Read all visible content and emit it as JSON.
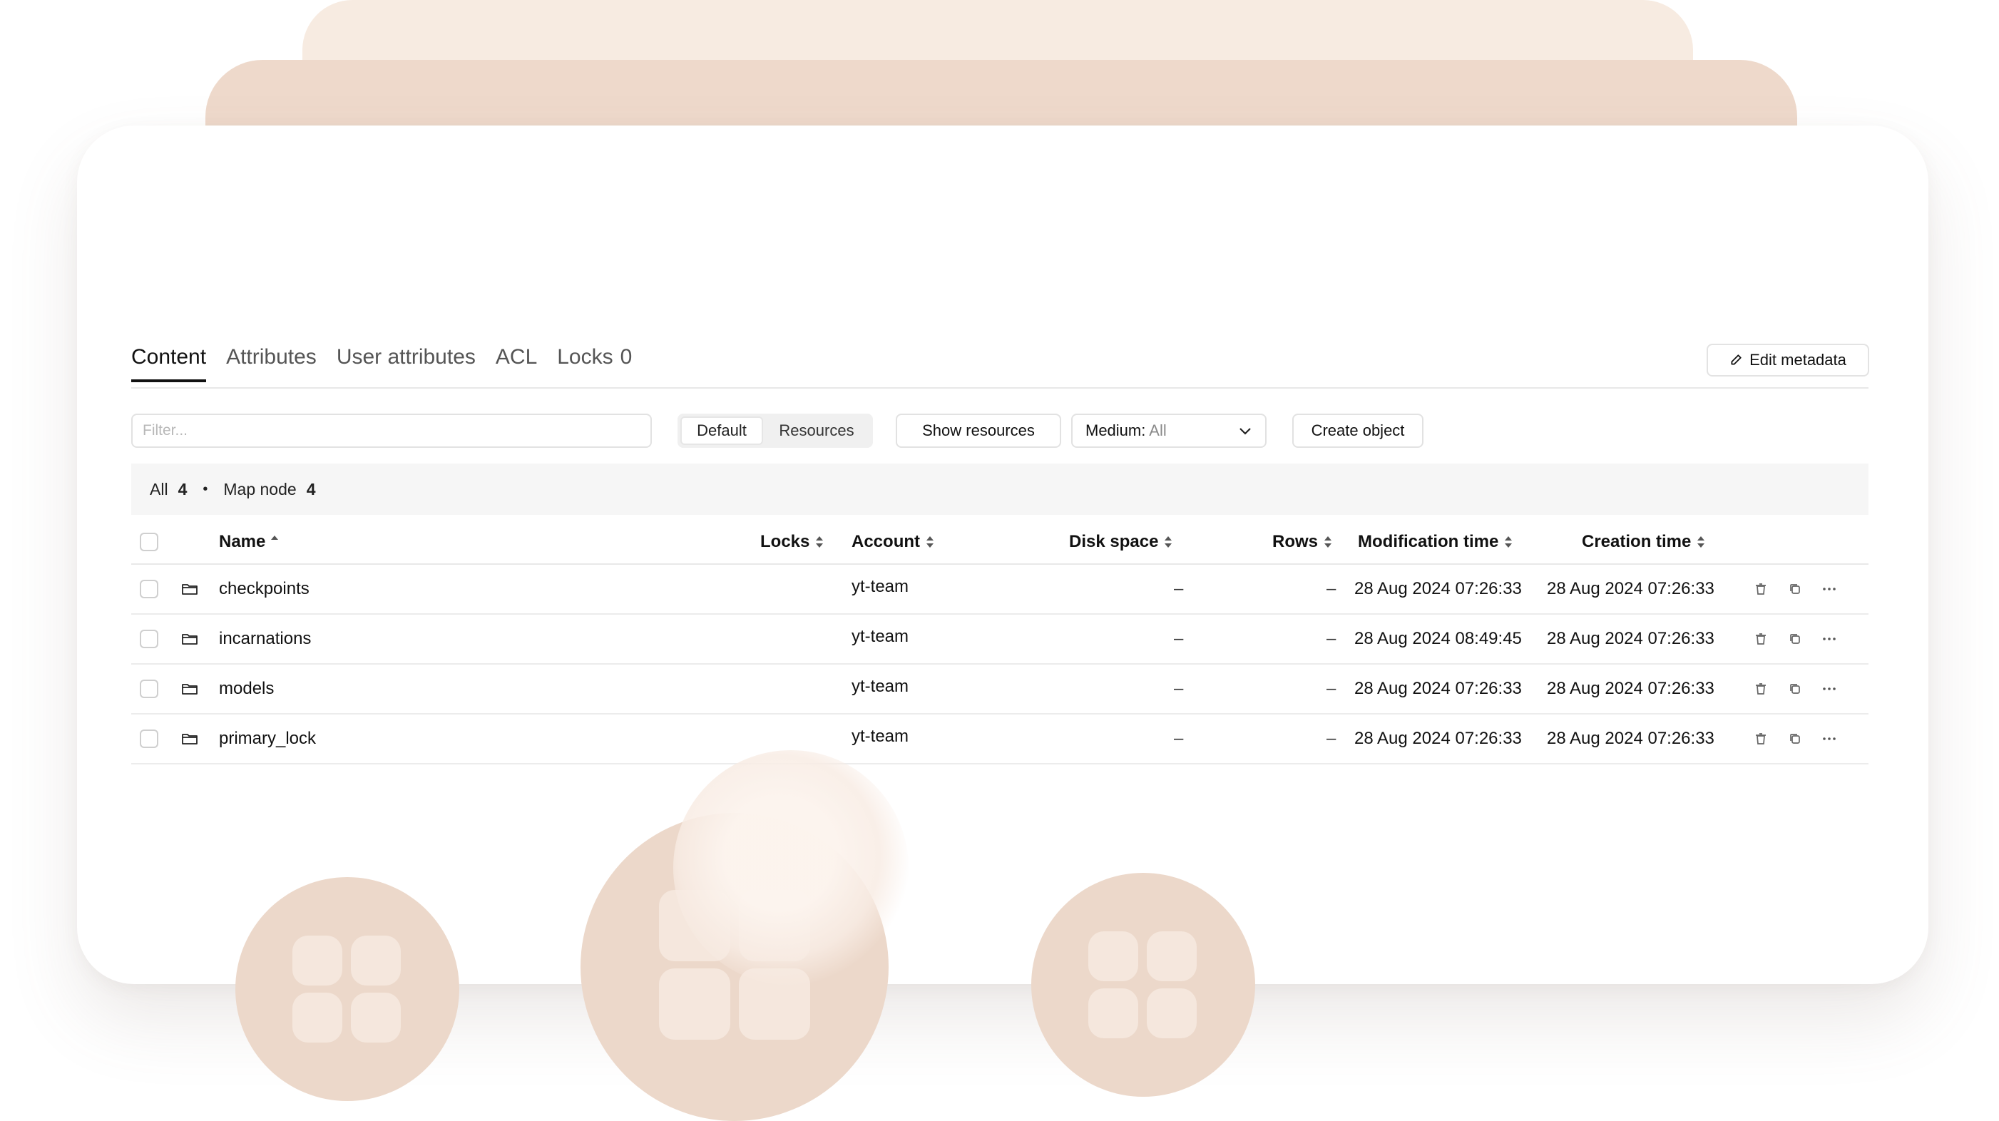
{
  "tabs": [
    {
      "label": "Content",
      "active": true
    },
    {
      "label": "Attributes"
    },
    {
      "label": "User attributes"
    },
    {
      "label": "ACL"
    },
    {
      "label": "Locks",
      "count": "0"
    }
  ],
  "edit_metadata_label": "Edit metadata",
  "toolbar": {
    "filter_placeholder": "Filter...",
    "view_default": "Default",
    "view_resources": "Resources",
    "show_resources": "Show resources",
    "medium_label": "Medium:",
    "medium_value": "All",
    "create_object": "Create object"
  },
  "summary": {
    "all_label": "All",
    "all_count": "4",
    "type_label": "Map node",
    "type_count": "4"
  },
  "columns": {
    "name": "Name",
    "locks": "Locks",
    "account": "Account",
    "disk_space": "Disk space",
    "rows": "Rows",
    "modification_time": "Modification time",
    "creation_time": "Creation time"
  },
  "rows": [
    {
      "name": "checkpoints",
      "account": "yt-team",
      "disk_space": "–",
      "rows": "–",
      "modified": "28 Aug 2024 07:26:33",
      "created": "28 Aug 2024 07:26:33"
    },
    {
      "name": "incarnations",
      "account": "yt-team",
      "disk_space": "–",
      "rows": "–",
      "modified": "28 Aug 2024 08:49:45",
      "created": "28 Aug 2024 07:26:33"
    },
    {
      "name": "models",
      "account": "yt-team",
      "disk_space": "–",
      "rows": "–",
      "modified": "28 Aug 2024 07:26:33",
      "created": "28 Aug 2024 07:26:33"
    },
    {
      "name": "primary_lock",
      "account": "yt-team",
      "disk_space": "–",
      "rows": "–",
      "modified": "28 Aug 2024 07:26:33",
      "created": "28 Aug 2024 07:26:33"
    }
  ],
  "icons": {
    "row_type": "folder-icon",
    "row_actions": [
      "trash-icon",
      "copy-icon",
      "more-icon"
    ],
    "edit": "pencil-icon",
    "dropdown": "chevron-down-icon",
    "decor_tiles": "grid-tiles-icon"
  },
  "colors": {
    "decor_light": "#f7ebe1",
    "decor_mid": "#eed9cb",
    "text": "#111111",
    "border": "#e2e2e2"
  }
}
